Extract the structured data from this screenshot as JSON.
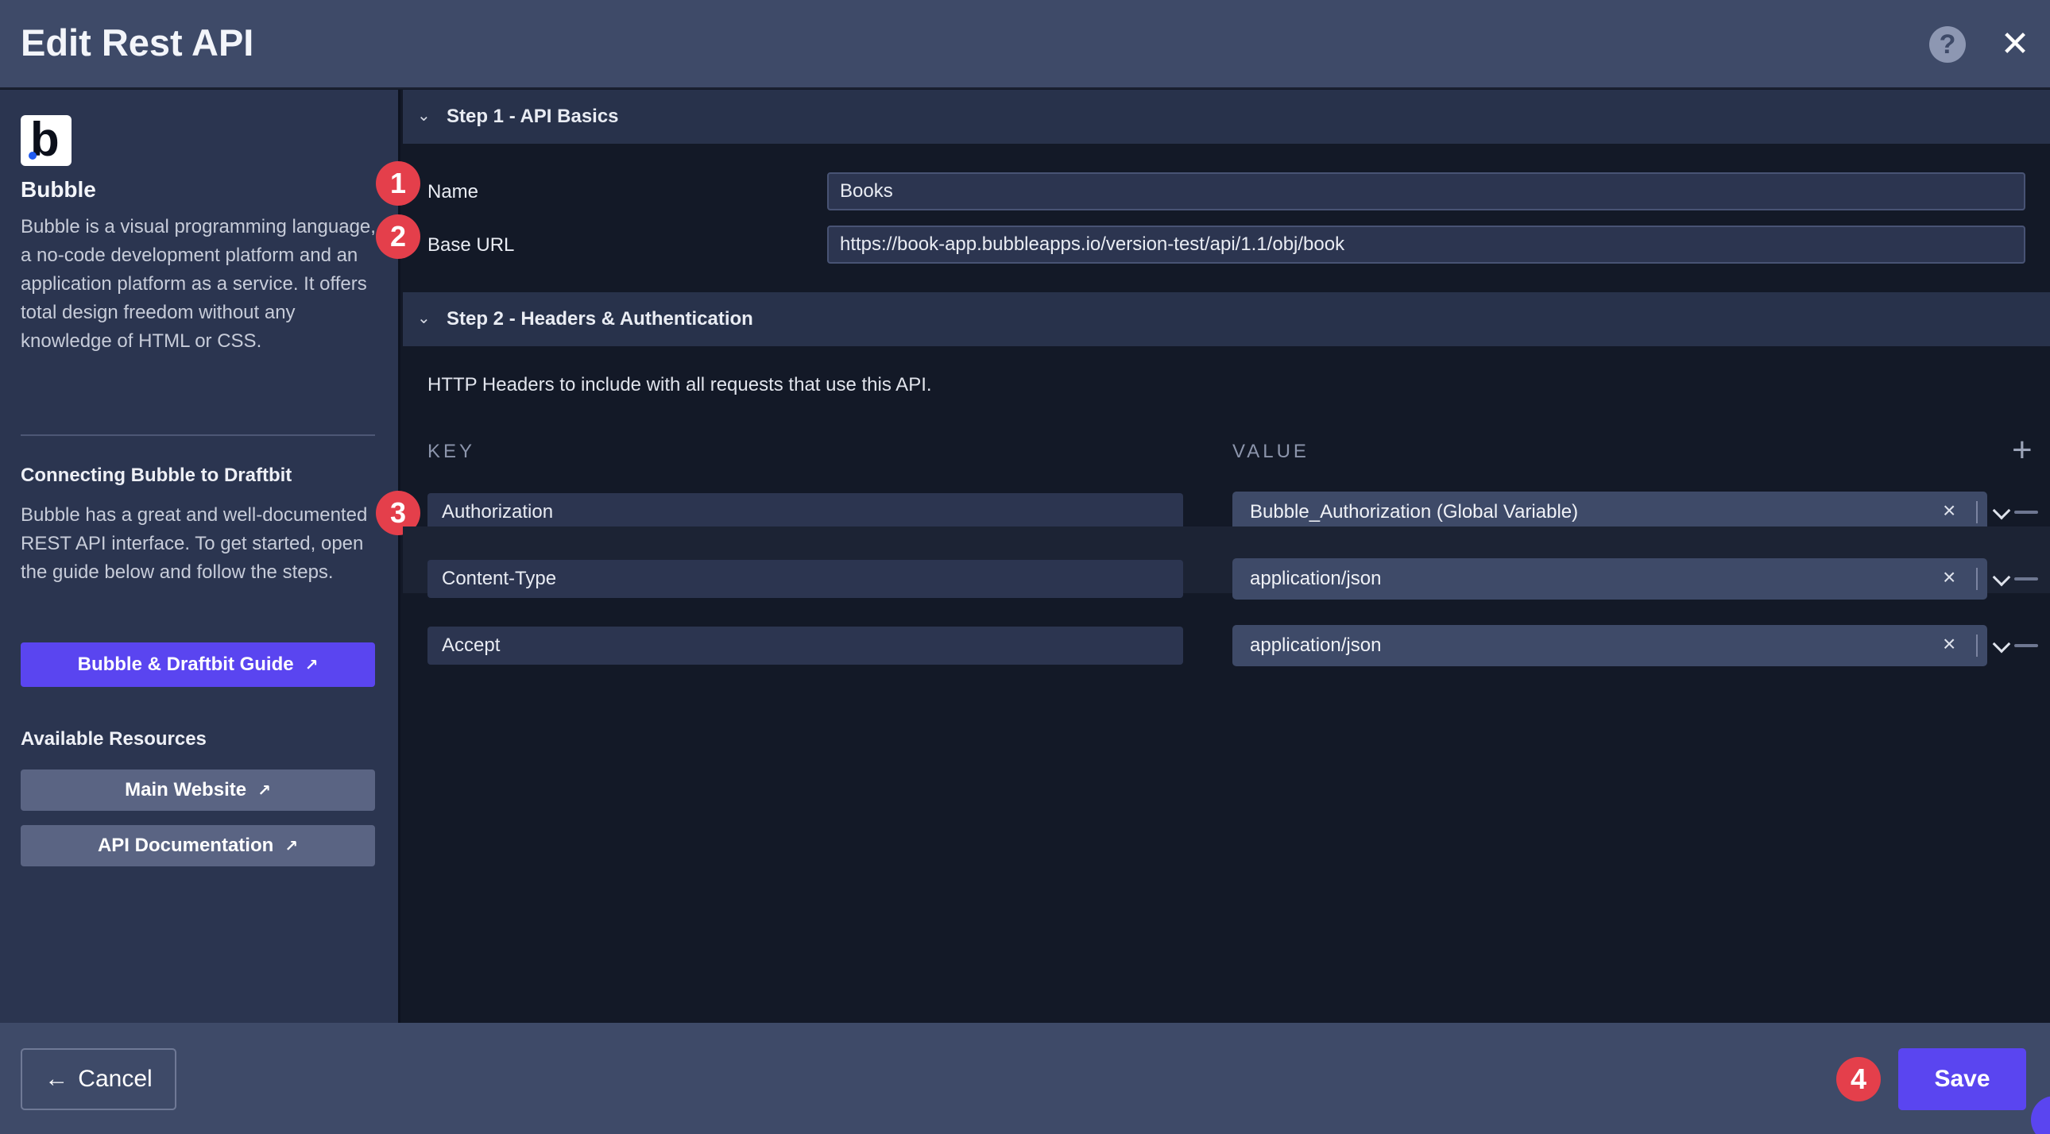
{
  "header": {
    "title": "Edit Rest API",
    "help_icon": "question-mark-icon",
    "close_icon": "close-icon"
  },
  "sidebar": {
    "logo_letter": "b",
    "name": "Bubble",
    "description": "Bubble is a visual programming language, a no-code development platform and an application platform as a service. It offers total design freedom without any knowledge of HTML or CSS.",
    "connect_heading": "Connecting Bubble to Draftbit",
    "connect_text": "Bubble has a great and well-documented REST API interface. To get started, open the guide below and follow the steps.",
    "guide_button": "Bubble & Draftbit Guide",
    "resources_heading": "Available Resources",
    "resources": [
      "Main Website",
      "API Documentation"
    ]
  },
  "step1": {
    "label": "Step 1 - API Basics",
    "name_label": "Name",
    "name_value": "Books",
    "base_url_label": "Base URL",
    "base_url_value": "https://book-app.bubbleapps.io/version-test/api/1.1/obj/book"
  },
  "step2": {
    "label": "Step 2 - Headers & Authentication",
    "helper": "HTTP Headers to include with all requests that use this API.",
    "key_header": "KEY",
    "value_header": "VALUE",
    "headers": [
      {
        "key": "Authorization",
        "value": "Bubble_Authorization (Global Variable)"
      },
      {
        "key": "Content-Type",
        "value": "application/json"
      },
      {
        "key": "Accept",
        "value": "application/json"
      }
    ]
  },
  "badges": [
    "1",
    "2",
    "3",
    "4"
  ],
  "footer": {
    "cancel": "Cancel",
    "save": "Save"
  },
  "colors": {
    "accent": "#5a45f0",
    "badge": "#e43f4b",
    "header": "#3e4a68",
    "sidebar": "#2b3550",
    "main": "#131927"
  }
}
